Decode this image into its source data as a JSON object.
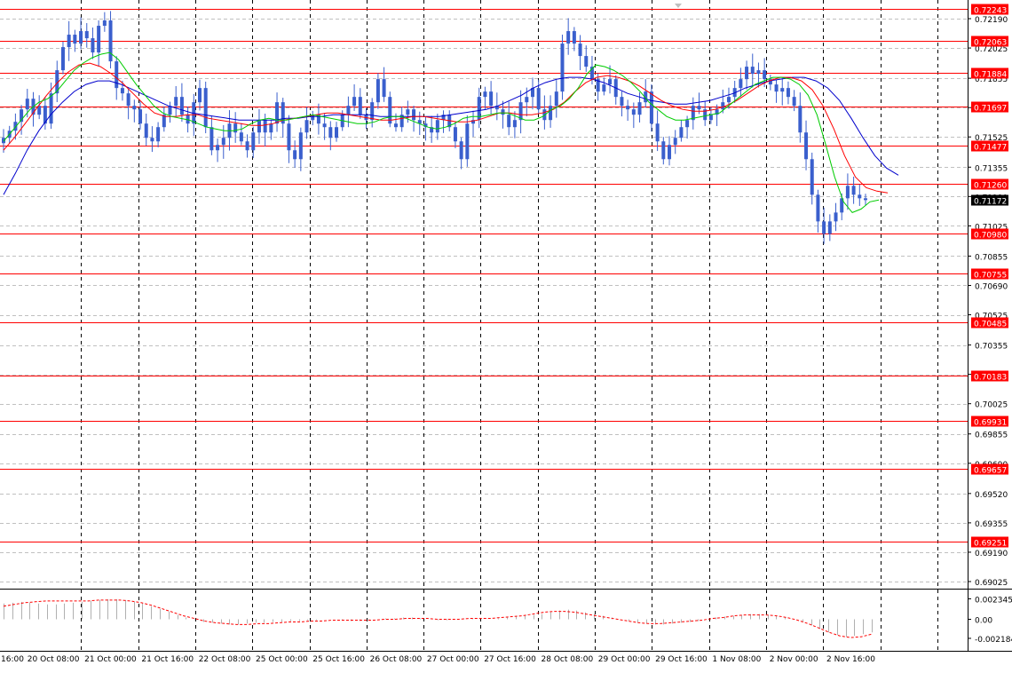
{
  "chart_data": {
    "type": "candlestick",
    "symbol_title": "",
    "price_axis": {
      "ylim": [
        0.69,
        0.72265
      ],
      "tick_labels": [
        "0.72190",
        "0.72025",
        "0.71855",
        "0.71690",
        "0.71525",
        "0.71355",
        "0.71190",
        "0.71025",
        "0.70855",
        "0.70690",
        "0.70525",
        "0.70355",
        "0.70190",
        "0.70025",
        "0.69855",
        "0.69690",
        "0.69520",
        "0.69355",
        "0.69190",
        "0.69025"
      ],
      "current_price": "0.71172"
    },
    "time_axis": {
      "tick_labels": [
        "16:00",
        "20 Oct 08:00",
        "21 Oct 00:00",
        "21 Oct 16:00",
        "22 Oct 08:00",
        "25 Oct 00:00",
        "25 Oct 16:00",
        "26 Oct 08:00",
        "27 Oct 00:00",
        "27 Oct 16:00",
        "28 Oct 08:00",
        "29 Oct 00:00",
        "29 Oct 16:00",
        "1 Nov 08:00",
        "2 Nov 00:00",
        "2 Nov 16:00"
      ]
    },
    "levels": [
      "0.72243",
      "0.72063",
      "0.71884",
      "0.71697",
      "0.71477",
      "0.71260",
      "0.70980",
      "0.70755",
      "0.70485",
      "0.70183",
      "0.69931",
      "0.69657",
      "0.69251"
    ],
    "price_series_closes": [
      0.7152,
      0.7156,
      0.7161,
      0.7168,
      0.7174,
      0.7165,
      0.717,
      0.716,
      0.7177,
      0.719,
      0.7203,
      0.721,
      0.7205,
      0.7212,
      0.7208,
      0.72,
      0.7215,
      0.7218,
      0.7195,
      0.718,
      0.7177,
      0.717,
      0.7168,
      0.716,
      0.7152,
      0.715,
      0.7158,
      0.7165,
      0.717,
      0.7175,
      0.7165,
      0.716,
      0.7172,
      0.718,
      0.7158,
      0.7145,
      0.7148,
      0.7152,
      0.716,
      0.7155,
      0.715,
      0.7145,
      0.7155,
      0.7162,
      0.7155,
      0.716,
      0.7172,
      0.716,
      0.7145,
      0.714,
      0.7155,
      0.7162,
      0.7165,
      0.716,
      0.7158,
      0.7152,
      0.7158,
      0.7165,
      0.717,
      0.7175,
      0.7165,
      0.7162,
      0.7172,
      0.7185,
      0.7175,
      0.716,
      0.7158,
      0.7165,
      0.7168,
      0.7162,
      0.716,
      0.7158,
      0.7155,
      0.7162,
      0.7165,
      0.7158,
      0.715,
      0.714,
      0.716,
      0.7162,
      0.7175,
      0.7178,
      0.717,
      0.7168,
      0.7165,
      0.7158,
      0.7162,
      0.7172,
      0.7175,
      0.718,
      0.7168,
      0.7162,
      0.717,
      0.7178,
      0.7205,
      0.7212,
      0.7205,
      0.7198,
      0.7192,
      0.7185,
      0.7178,
      0.7182,
      0.7185,
      0.7175,
      0.717,
      0.7168,
      0.7165,
      0.7172,
      0.7178,
      0.716,
      0.715,
      0.714,
      0.7148,
      0.7152,
      0.7158,
      0.7162,
      0.717,
      0.7168,
      0.7162,
      0.7165,
      0.7168,
      0.7172,
      0.7175,
      0.718,
      0.7185,
      0.7192,
      0.7188,
      0.719,
      0.7185,
      0.7182,
      0.7178,
      0.718,
      0.7175,
      0.717,
      0.7155,
      0.714,
      0.712,
      0.7105,
      0.7098,
      0.7105,
      0.711,
      0.7118,
      0.7125,
      0.712,
      0.7118,
      0.7117
    ],
    "price_series_ma_fast": [
      0.715,
      0.7156,
      0.7162,
      0.7168,
      0.7172,
      0.7174,
      0.7178,
      0.7184,
      0.719,
      0.7194,
      0.7197,
      0.7199,
      0.72,
      0.7196,
      0.7189,
      0.7182,
      0.7176,
      0.717,
      0.7166,
      0.7164,
      0.7163,
      0.7162,
      0.716,
      0.7158,
      0.7157,
      0.7156,
      0.7156,
      0.7157,
      0.716,
      0.7162,
      0.7163,
      0.7162,
      0.7162,
      0.7163,
      0.7164,
      0.7165,
      0.7164,
      0.7163,
      0.7162,
      0.7161,
      0.716,
      0.716,
      0.7161,
      0.7163,
      0.7164,
      0.7164,
      0.7162,
      0.716,
      0.7158,
      0.7157,
      0.7158,
      0.716,
      0.7163,
      0.7164,
      0.7164,
      0.7165,
      0.7166,
      0.7166,
      0.7164,
      0.7162,
      0.7162,
      0.7164,
      0.7168,
      0.717,
      0.7174,
      0.718,
      0.7188,
      0.7193,
      0.7192,
      0.719,
      0.7187,
      0.7183,
      0.7178,
      0.7172,
      0.7168,
      0.7164,
      0.7162,
      0.7162,
      0.7163,
      0.7164,
      0.7165,
      0.7166,
      0.717,
      0.7174,
      0.7178,
      0.7182,
      0.7184,
      0.7186,
      0.7186,
      0.7185,
      0.7182,
      0.7176,
      0.7165,
      0.7148,
      0.713,
      0.7116,
      0.711,
      0.7112,
      0.7116,
      0.7117
    ],
    "price_series_ma_mid": [
      0.7145,
      0.7152,
      0.716,
      0.7168,
      0.7176,
      0.7183,
      0.7189,
      0.7193,
      0.7194,
      0.7192,
      0.7188,
      0.7183,
      0.7177,
      0.7171,
      0.7166,
      0.7164,
      0.7164,
      0.7165,
      0.7165,
      0.7163,
      0.7162,
      0.7161,
      0.716,
      0.7159,
      0.7159,
      0.716,
      0.7162,
      0.7163,
      0.7164,
      0.7165,
      0.7166,
      0.7166,
      0.7165,
      0.7164,
      0.7163,
      0.7162,
      0.7162,
      0.7163,
      0.7164,
      0.7164,
      0.7163,
      0.7162,
      0.7161,
      0.7161,
      0.7162,
      0.7164,
      0.7166,
      0.7166,
      0.7165,
      0.7165,
      0.7166,
      0.7168,
      0.7172,
      0.7178,
      0.7183,
      0.7186,
      0.7187,
      0.7186,
      0.7184,
      0.7181,
      0.7177,
      0.7173,
      0.717,
      0.7168,
      0.7167,
      0.7167,
      0.7168,
      0.717,
      0.7173,
      0.7177,
      0.7181,
      0.7184,
      0.7186,
      0.7186,
      0.7184,
      0.7179,
      0.717,
      0.7157,
      0.7142,
      0.713,
      0.7124,
      0.7122,
      0.7121
    ],
    "price_series_ma_slow": [
      0.712,
      0.7132,
      0.7145,
      0.7156,
      0.7165,
      0.7172,
      0.7178,
      0.7182,
      0.7184,
      0.7184,
      0.7182,
      0.7179,
      0.7176,
      0.7173,
      0.717,
      0.7168,
      0.7166,
      0.7165,
      0.7164,
      0.7163,
      0.7162,
      0.7162,
      0.7162,
      0.7162,
      0.7163,
      0.7163,
      0.7164,
      0.7164,
      0.7165,
      0.7165,
      0.7165,
      0.7165,
      0.7164,
      0.7164,
      0.7164,
      0.7164,
      0.7164,
      0.7164,
      0.7165,
      0.7166,
      0.7167,
      0.7168,
      0.717,
      0.7173,
      0.7176,
      0.718,
      0.7183,
      0.7185,
      0.7186,
      0.7186,
      0.7185,
      0.7183,
      0.718,
      0.7177,
      0.7175,
      0.7173,
      0.7172,
      0.7171,
      0.7171,
      0.7172,
      0.7173,
      0.7175,
      0.7177,
      0.718,
      0.7182,
      0.7184,
      0.7185,
      0.7186,
      0.7186,
      0.7184,
      0.718,
      0.7173,
      0.7163,
      0.7152,
      0.7142,
      0.7135,
      0.7131
    ],
    "oscillator": {
      "tick_labels": [
        "0.002345",
        "0.00",
        "-0.002184"
      ],
      "histogram": [
        0.0018,
        0.0019,
        0.002,
        0.0019,
        0.0018,
        0.0017,
        0.0017,
        0.0018,
        0.0019,
        0.002,
        0.0021,
        0.0022,
        0.0023,
        0.0023,
        0.0022,
        0.002,
        0.0018,
        0.0015,
        0.0012,
        0.0009,
        0.0005,
        0.0002,
        -0.0001,
        -0.0003,
        -0.0004,
        -0.0005,
        -0.0006,
        -0.0006,
        -0.0005,
        -0.0004,
        -0.0004,
        -0.0003,
        -0.0003,
        -0.0002,
        -0.0002,
        -0.0001,
        -0.0001,
        0.0,
        0.0,
        -0.0001,
        -0.0002,
        -0.0002,
        -0.0001,
        0.0,
        0.0001,
        0.0001,
        0.0002,
        0.0002,
        0.0001,
        0.0,
        -0.0001,
        -0.0001,
        0.0,
        0.0001,
        0.0001,
        0.0,
        0.0,
        0.0001,
        0.0002,
        0.0003,
        0.0004,
        0.0005,
        0.0006,
        0.0008,
        0.001,
        0.0011,
        0.001,
        0.0008,
        0.0006,
        0.0004,
        0.0002,
        0.0,
        -0.0002,
        -0.0004,
        -0.0005,
        -0.0006,
        -0.0006,
        -0.0005,
        -0.0004,
        -0.0003,
        -0.0002,
        0.0,
        0.0002,
        0.0003,
        0.0004,
        0.0005,
        0.0006,
        0.0006,
        0.0005,
        0.0004,
        0.0002,
        0.0,
        -0.0003,
        -0.0007,
        -0.0011,
        -0.0015,
        -0.0018,
        -0.002,
        -0.0019,
        -0.0017,
        -0.0015
      ],
      "signal": [
        0.0015,
        0.0017,
        0.0019,
        0.002,
        0.0021,
        0.0021,
        0.0021,
        0.0021,
        0.0021,
        0.0022,
        0.0022,
        0.0022,
        0.0021,
        0.0019,
        0.0016,
        0.0012,
        0.0008,
        0.0004,
        0.0001,
        -0.0002,
        -0.0004,
        -0.0005,
        -0.0006,
        -0.0006,
        -0.0005,
        -0.0005,
        -0.0004,
        -0.0003,
        -0.0003,
        -0.0002,
        -0.0002,
        -0.0001,
        -0.0001,
        -0.0001,
        -0.0001,
        -0.0001,
        0.0,
        0.0,
        0.0001,
        0.0001,
        0.0001,
        0.0,
        0.0,
        0.0,
        0.0001,
        0.0001,
        0.0001,
        0.0002,
        0.0003,
        0.0004,
        0.0006,
        0.0008,
        0.0009,
        0.0009,
        0.0008,
        0.0006,
        0.0004,
        0.0002,
        0.0,
        -0.0002,
        -0.0004,
        -0.0005,
        -0.0005,
        -0.0004,
        -0.0003,
        -0.0002,
        -0.0001,
        0.0001,
        0.0002,
        0.0004,
        0.0005,
        0.0005,
        0.0005,
        0.0004,
        0.0002,
        -0.0001,
        -0.0005,
        -0.001,
        -0.0015,
        -0.0019,
        -0.0021,
        -0.002,
        -0.0017
      ]
    },
    "colors": {
      "background": "#ffffff",
      "grid": "#c0c0c0",
      "vgrid": "#000000",
      "candles": "#3a5fcd",
      "level_line": "#ff0000",
      "level_label_bg": "#ff0000",
      "level_label_text": "#ffffff",
      "current_label_bg": "#000000",
      "current_label_text": "#ffffff",
      "ma_fast": "#00cc00",
      "ma_mid": "#ff0000",
      "ma_slow": "#0000cc",
      "oscillator_bars": "#b0b0b0",
      "oscillator_signal": "#ff0000",
      "axis_text": "#000000"
    }
  }
}
